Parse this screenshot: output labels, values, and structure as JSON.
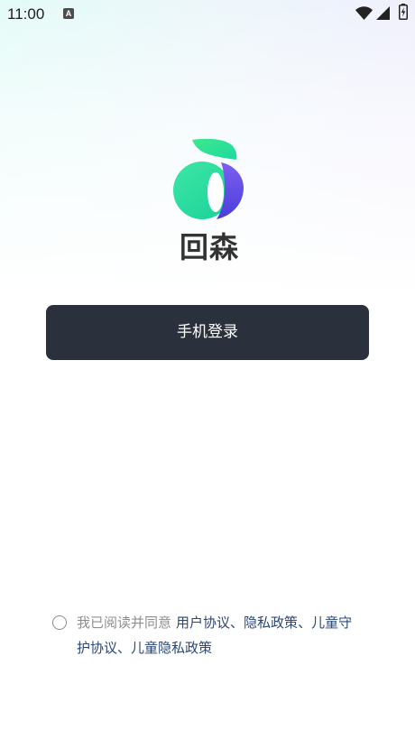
{
  "status_bar": {
    "time": "11:00",
    "notification_badge": "A",
    "icons": {
      "notification": "a-notification-icon",
      "wifi": "wifi-icon",
      "signal": "cell-signal-icon",
      "battery": "battery-charging-icon"
    }
  },
  "app": {
    "logo_icon": "huisen-logo-icon",
    "name": "回森"
  },
  "login": {
    "phone_login_label": "手机登录"
  },
  "agreement": {
    "checked": false,
    "radio_icon": "radio-unchecked-icon",
    "prefix": "我已阅读并同意",
    "links": [
      "用户协议",
      "隐私政策",
      "儿童守护协议",
      "儿童隐私政策"
    ],
    "separator": "、"
  },
  "colors": {
    "button_background": "#2b313c",
    "button_text": "#ffffff",
    "link": "#2a4778",
    "muted_text": "#8e8e8e",
    "logo_text": "#333333",
    "logo_green": "#2fe0a0",
    "logo_purple": "#5a46e4",
    "background_top_left": "#e4fbf8",
    "background_top_right": "#f0ebfd"
  }
}
